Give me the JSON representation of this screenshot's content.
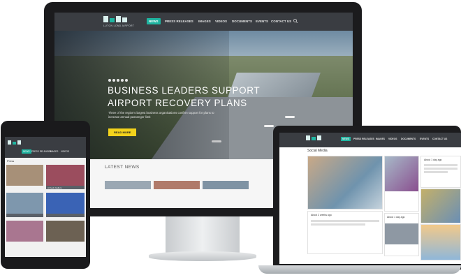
{
  "brand": {
    "logo_subtitle": "LUTON LOND AIRPORT",
    "accent": "#1fb5a1",
    "cta_color": "#f3d31c"
  },
  "desktop": {
    "nav": [
      "NEWS",
      "PRESS RELEASES",
      "IMAGES",
      "VIDEOS",
      "DOCUMENTS",
      "EVENTS",
      "CONTACT US"
    ],
    "active_nav": "NEWS",
    "hero": {
      "title_line1": "BUSINESS LEADERS SUPPORT",
      "title_line2": "AIRPORT RECOVERY PLANS",
      "text": "Three of the region's largest business organisations confirm support for plans to increase annual passenger limit",
      "button": "READ MORE"
    },
    "latest_news": "LATEST NEWS"
  },
  "tablet": {
    "nav": [
      "NEWS",
      "PRESS RELEASES",
      "IMAGES",
      "VIDEOS"
    ],
    "section": "Press",
    "captions": [
      "",
      "Arrivals Gallery",
      "",
      "",
      "",
      ""
    ]
  },
  "laptop": {
    "nav": [
      "NEWS",
      "PRESS RELEASES",
      "IMAGES",
      "VIDEOS",
      "DOCUMENTS",
      "EVENTS",
      "CONTACT US"
    ],
    "section": "Social Media",
    "posts": [
      {
        "meta": "About 1 day ago"
      },
      {
        "meta": "About 1 day ago"
      },
      {
        "meta": "About 2 weeks ago"
      },
      {
        "meta": "About 2 weeks ago"
      }
    ]
  }
}
